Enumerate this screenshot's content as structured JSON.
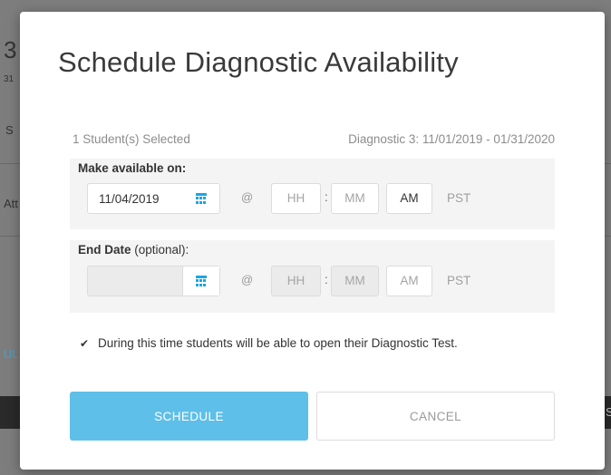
{
  "background": {
    "frag_1": "3",
    "frag_2": "31",
    "frag_3": "S",
    "frag_4": "Att",
    "frag_5": "UL",
    "frag_6": "S"
  },
  "modal": {
    "title": "Schedule Diagnostic Availability",
    "students_selected": "1 Student(s) Selected",
    "diagnostic_range": "Diagnostic 3: 11/01/2019 - 01/31/2020",
    "available": {
      "label": "Make available on:",
      "date": "11/04/2019",
      "at": "@",
      "hh_placeholder": "HH",
      "mm_placeholder": "MM",
      "colon": ":",
      "ampm": "AM",
      "timezone": "PST"
    },
    "end": {
      "label_bold": "End Date",
      "label_optional": " (optional):",
      "date": "",
      "at": "@",
      "hh_placeholder": "HH",
      "mm_placeholder": "MM",
      "colon": ":",
      "ampm": "AM",
      "timezone": "PST"
    },
    "note": "During this time students will be able to open their Diagnostic Test.",
    "schedule_label": "SCHEDULE",
    "cancel_label": "CANCEL"
  },
  "colors": {
    "accent": "#5ebfe8",
    "icon": "#1aa6e0"
  },
  "icons": [
    "calendar-icon",
    "checkmark-icon"
  ]
}
